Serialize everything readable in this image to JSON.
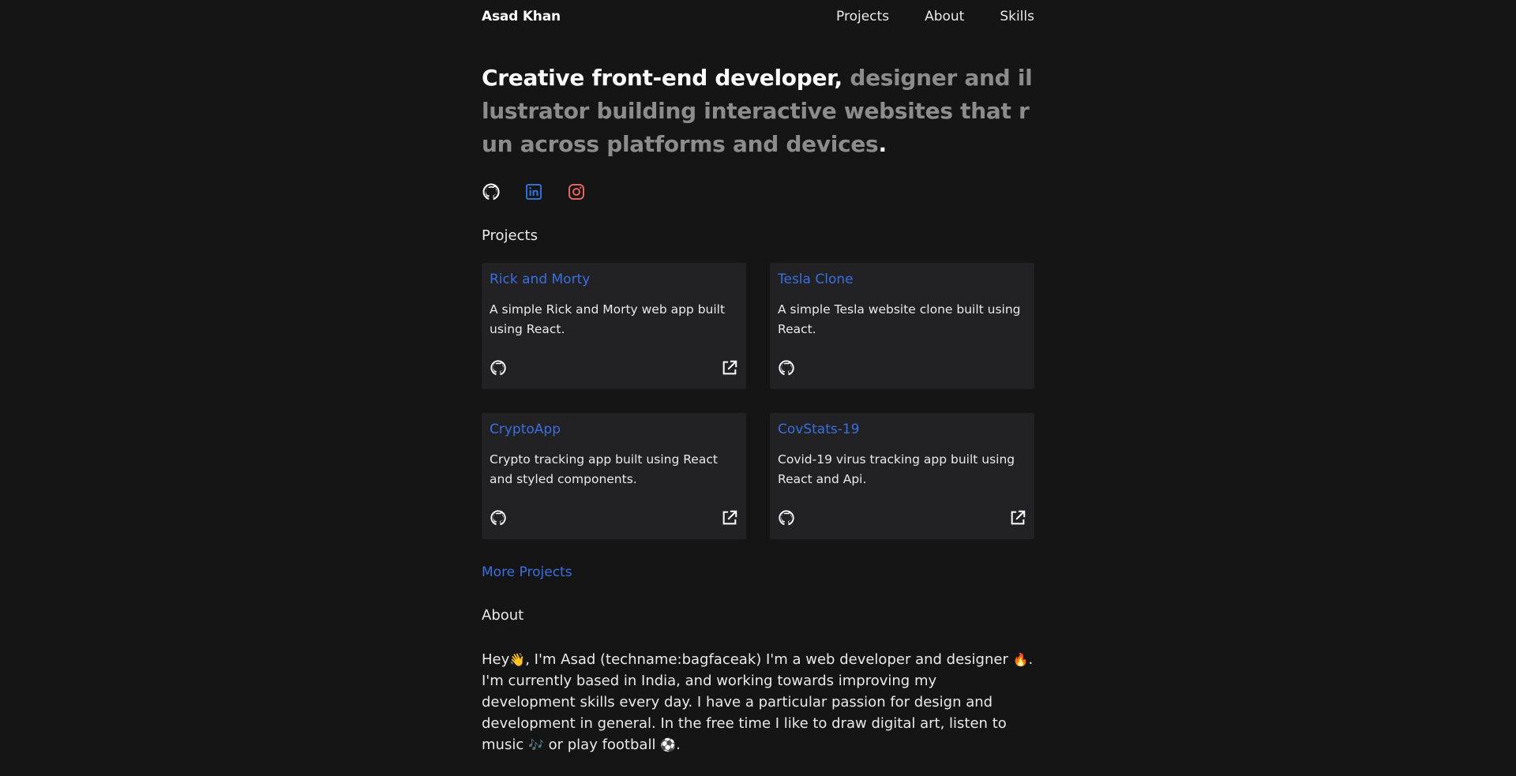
{
  "nav": {
    "brand": "Asad Khan",
    "links": [
      "Projects",
      "About",
      "Skills"
    ]
  },
  "hero": {
    "strong": "Creative front-end developer,",
    "muted": "designer and illustrator building interactive websites that run across platforms and devices",
    "end": "."
  },
  "social": {
    "icons": [
      "github-icon",
      "linkedin-icon",
      "instagram-icon"
    ],
    "colors": {
      "github": "#ffffff",
      "linkedin": "#2f6fd8",
      "instagram": "#e5645f"
    }
  },
  "projects": {
    "title": "Projects",
    "items": [
      {
        "title": "Rick and Morty",
        "desc": "A simple Rick and Morty web app built using React.",
        "live": true
      },
      {
        "title": "Tesla Clone",
        "desc": "A simple Tesla website clone built using React.",
        "live": false
      },
      {
        "title": "CryptoApp",
        "desc": "Crypto tracking app built using React and styled components.",
        "live": true
      },
      {
        "title": "CovStats-19",
        "desc": "Covid-19 virus tracking app built using React and Api.",
        "live": true
      }
    ],
    "more": "More Projects"
  },
  "about": {
    "title": "About",
    "p1": "Hey",
    "e1": "👋",
    "p2": ", I'm Asad (techname:bagfaceak) I'm a web developer and designer ",
    "e2": "🔥",
    "p3": ". I'm currently based in India, and working towards improving my development skills every day. I have a particular passion for design and development in general. In the free time I like to draw digital art, listen to music ",
    "e3": "🎶",
    "p4": " or play football ",
    "e4": "⚽",
    "p5": "."
  },
  "colors": {
    "background": "#151515",
    "card": "#222224",
    "accent": "#3a6fe0",
    "muted": "#8c8c8c"
  }
}
